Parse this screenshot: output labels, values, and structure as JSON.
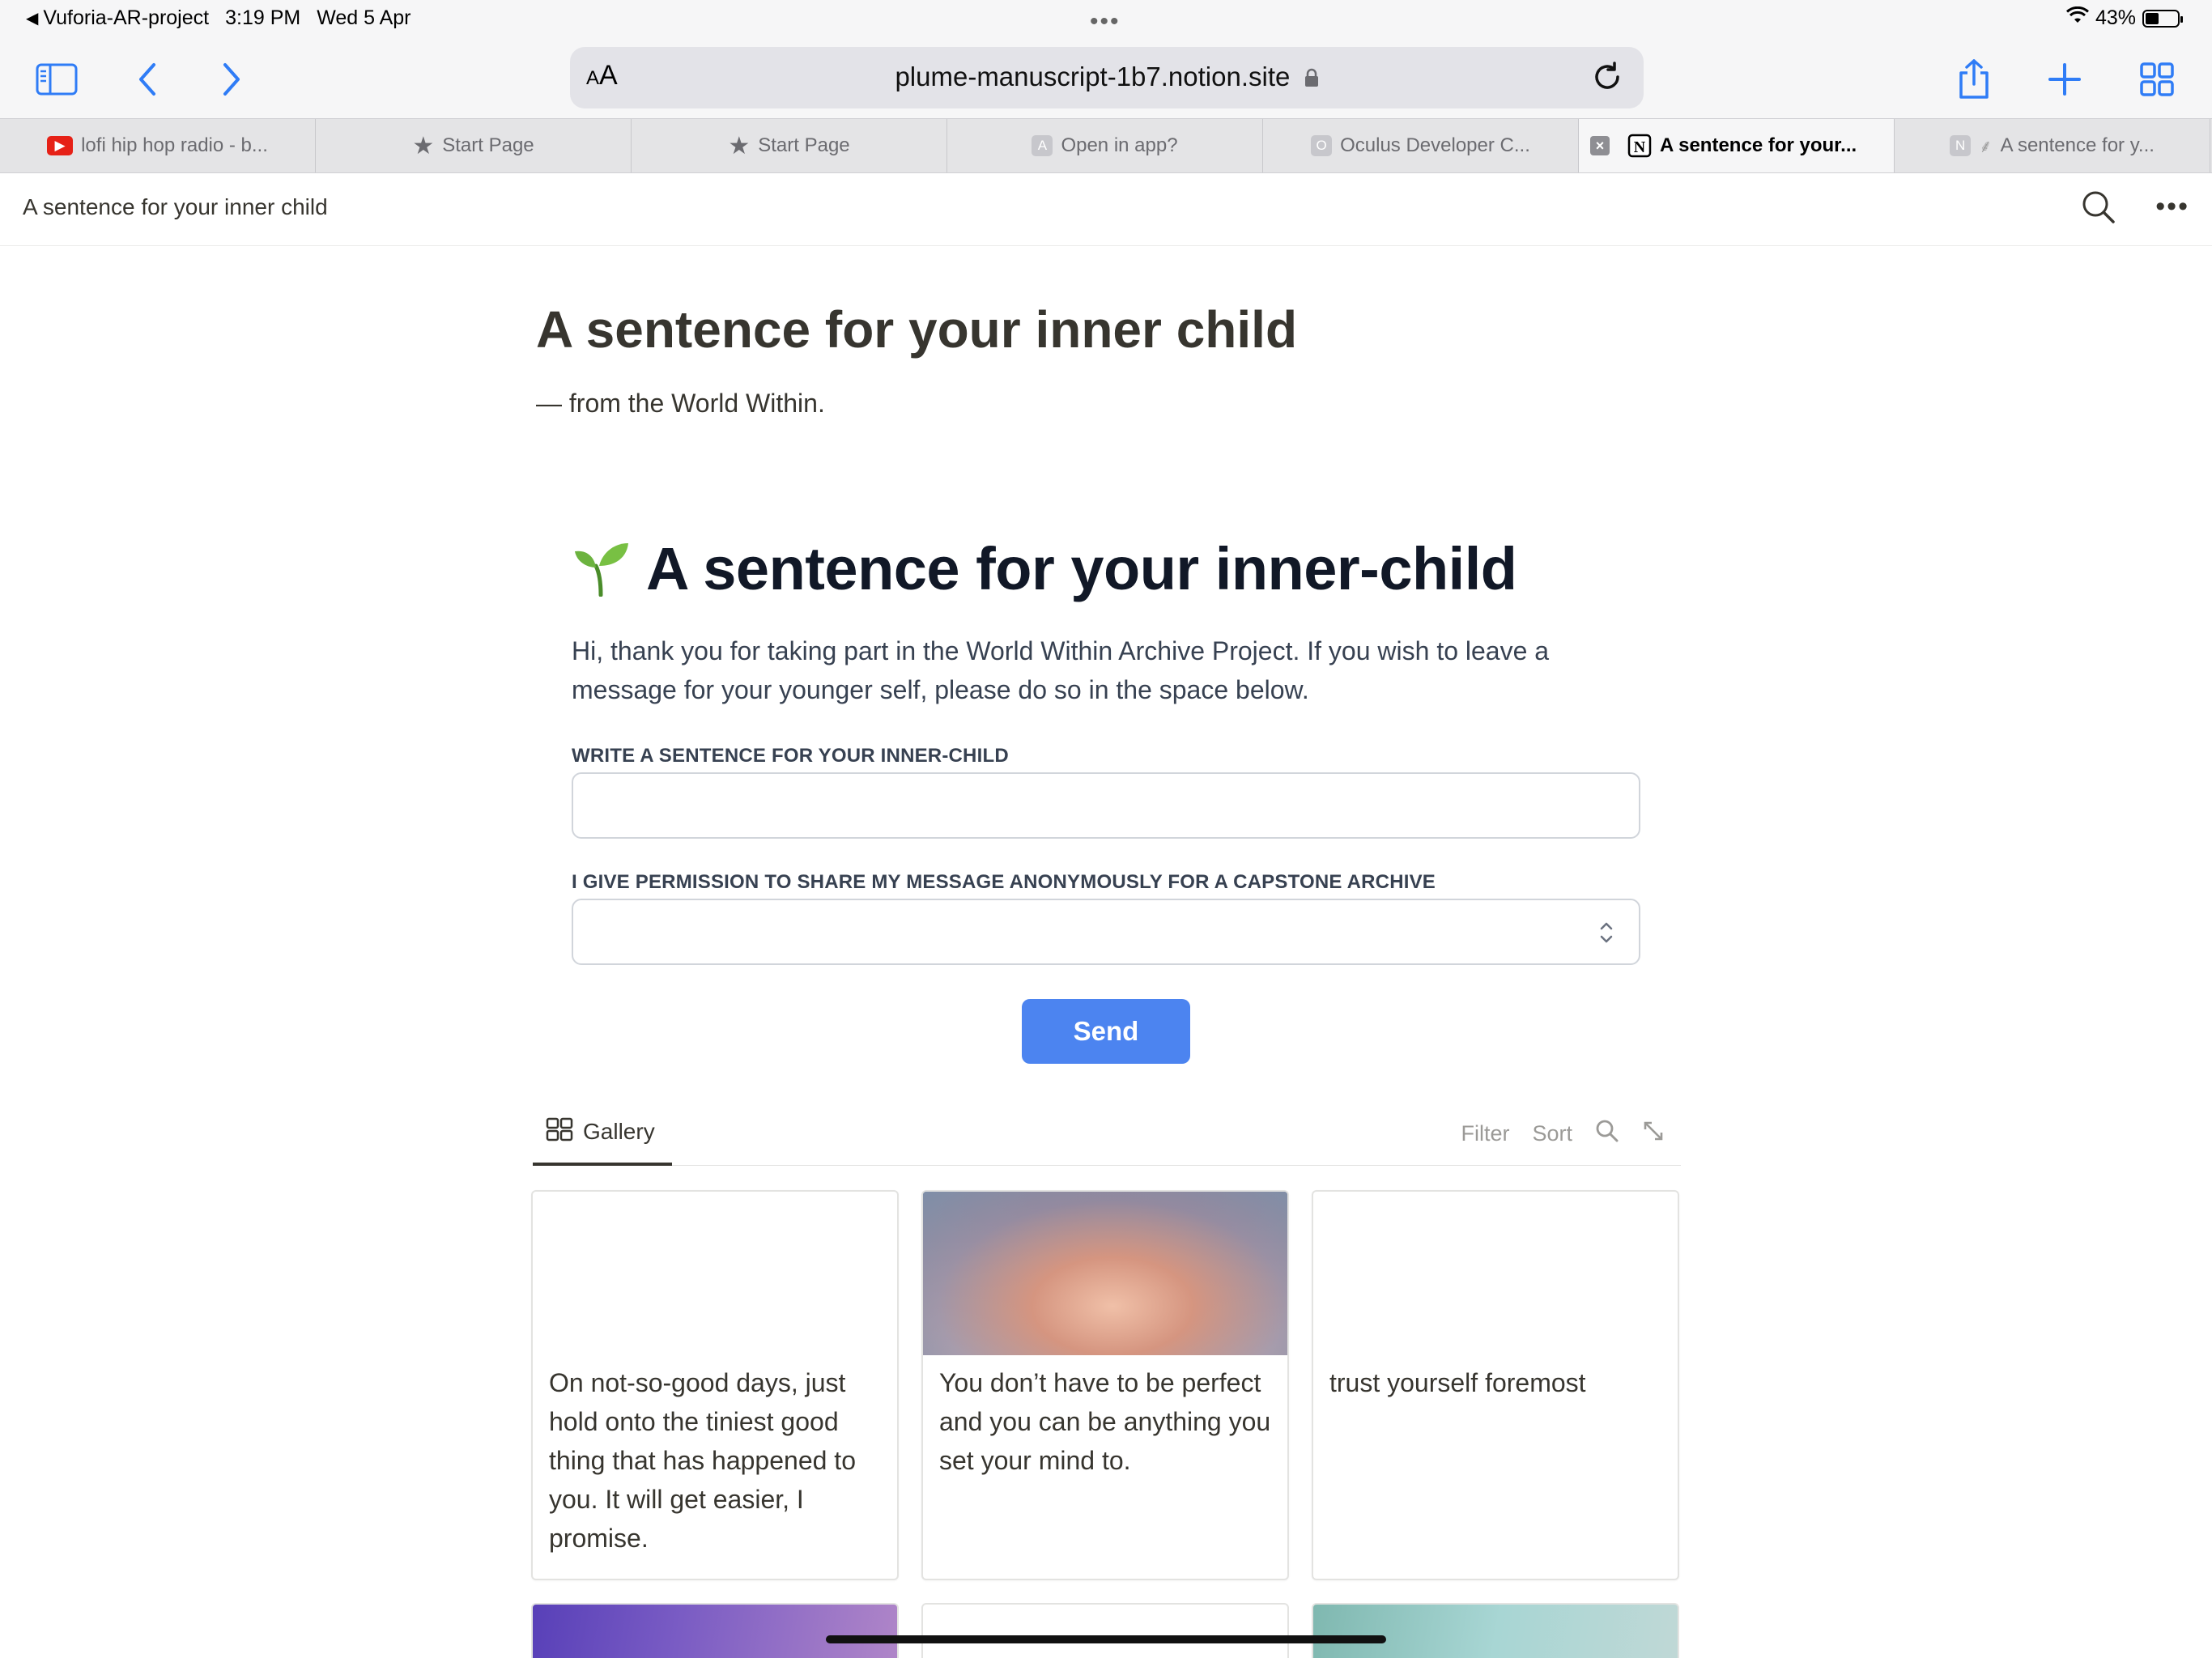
{
  "status_bar": {
    "back_app": "Vuforia-AR-project",
    "time": "3:19 PM",
    "date": "Wed 5 Apr",
    "battery": "43%",
    "battery_level": 0.43
  },
  "toolbar": {
    "text_size_label": "AA",
    "url": "plume-manuscript-1b7.notion.site"
  },
  "tabs": [
    {
      "label": "lofi hip hop radio - b...",
      "icon": "youtube-icon"
    },
    {
      "label": "Start Page",
      "icon": "star-icon"
    },
    {
      "label": "Start Page",
      "icon": "star-icon"
    },
    {
      "label": "Open in app?",
      "icon": "letter-a-icon",
      "fav": "A"
    },
    {
      "label": "Oculus Developer C...",
      "icon": "letter-o-icon",
      "fav": "O"
    },
    {
      "label": "A sentence for your...",
      "icon": "notion-icon",
      "active": true
    },
    {
      "label": "A sentence for y...",
      "icon": "letter-n-icon",
      "fav": "N"
    }
  ],
  "page_header": {
    "title": "A sentence for your inner child"
  },
  "page": {
    "title": "A sentence for your inner child",
    "subtitle": "— from the World Within."
  },
  "form": {
    "emoji": "🌱",
    "heading": "A sentence for your inner-child",
    "description": "Hi, thank you for taking part in the World Within Archive Project. If you wish to leave a message for your younger self, please do so in the space below.",
    "field1_label": "WRITE A SENTENCE FOR YOUR INNER-CHILD",
    "field1_value": "",
    "field2_label": "I GIVE PERMISSION TO SHARE MY MESSAGE ANONYMOUSLY FOR A CAPSTONE ARCHIVE",
    "field2_value": "",
    "send_label": "Send"
  },
  "gallery": {
    "tab_label": "Gallery",
    "filter_label": "Filter",
    "sort_label": "Sort",
    "cards": [
      {
        "text": "On not-so-good days, just hold onto the tiniest good thing that has happened to you. It will get easier, I promise.",
        "cover": "none"
      },
      {
        "text": "You don’t have to be perfect and you can be anything you set your mind to.",
        "cover": "gradient-peach"
      },
      {
        "text": "trust yourself foremost",
        "cover": "none"
      }
    ]
  }
}
